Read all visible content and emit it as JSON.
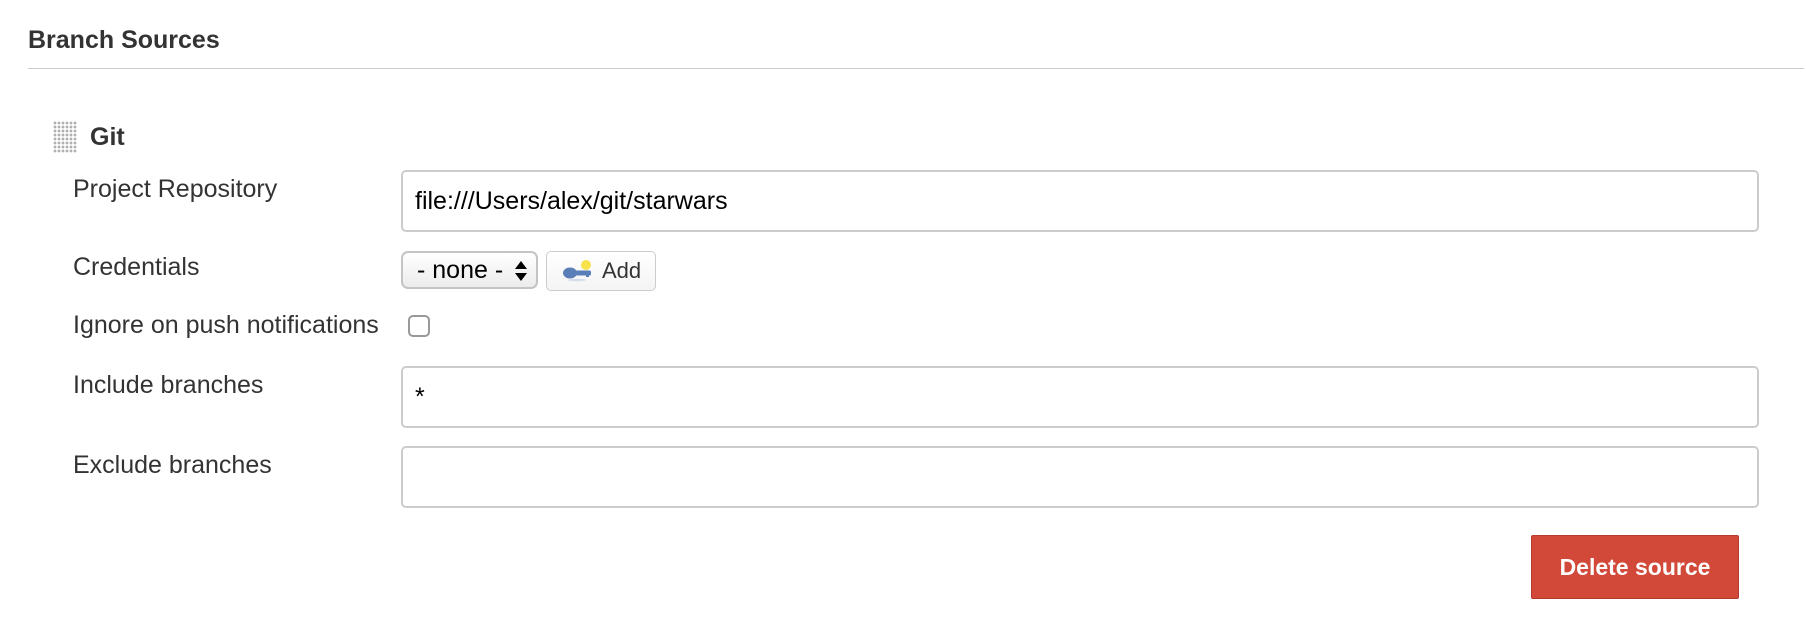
{
  "section": {
    "title": "Branch Sources"
  },
  "source": {
    "title": "Git",
    "fields": {
      "project_repository": {
        "label": "Project Repository",
        "value": "file:///Users/alex/git/starwars"
      },
      "credentials": {
        "label": "Credentials",
        "selected": "- none -",
        "add_label": "Add"
      },
      "ignore_push": {
        "label": "Ignore on push notifications",
        "checked": false
      },
      "include_branches": {
        "label": "Include branches",
        "value": "*"
      },
      "exclude_branches": {
        "label": "Exclude branches",
        "value": ""
      }
    },
    "delete_label": "Delete source"
  },
  "icons": {
    "drag": "drag-handle-icon",
    "credentials_add": "key-icon",
    "select_arrows": "select-arrows-icon"
  },
  "colors": {
    "danger": "#d24939",
    "text": "#333333",
    "border": "#cccccc"
  }
}
